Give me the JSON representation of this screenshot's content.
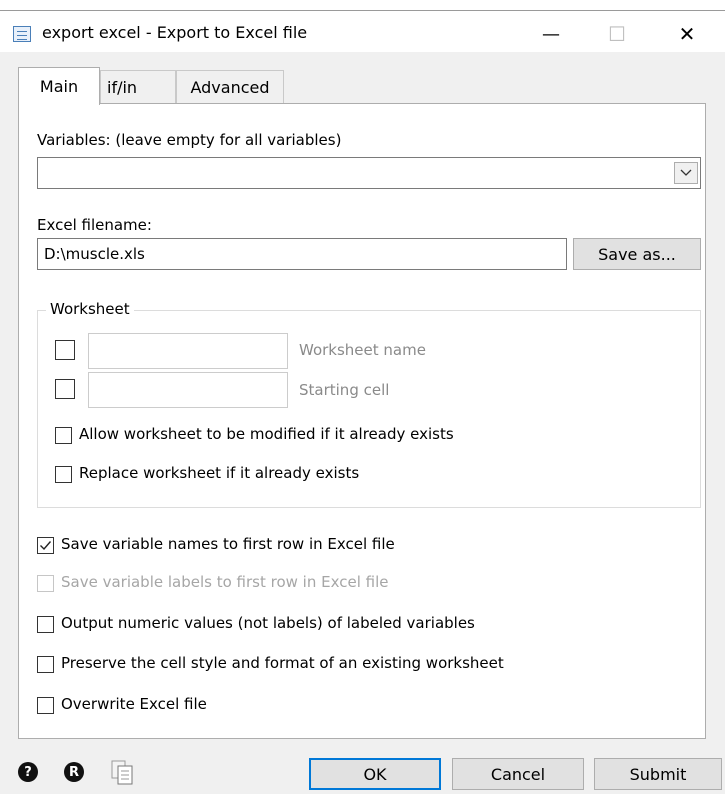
{
  "window": {
    "title": "export excel - Export to Excel file",
    "minimize_glyph": "—",
    "maximize_glyph": "☐",
    "close_glyph": "✕"
  },
  "tabs": [
    {
      "label": "Main",
      "active": true
    },
    {
      "label": "if/in",
      "active": false
    },
    {
      "label": "Advanced",
      "active": false
    }
  ],
  "variables": {
    "label": "Variables: (leave empty for all variables)",
    "value": ""
  },
  "excel": {
    "label": "Excel filename:",
    "value": "D:\\muscle.xls",
    "save_as_label": "Save as..."
  },
  "worksheet": {
    "group_title": "Worksheet",
    "name_label": "Worksheet name",
    "name_checked": false,
    "cell_label": "Starting cell",
    "cell_checked": false,
    "modify_label": "Allow worksheet to be modified if it already exists",
    "modify_checked": false,
    "replace_label": "Replace worksheet if it already exists",
    "replace_checked": false
  },
  "options": [
    {
      "label": "Save variable names to first row in Excel file",
      "checked": true,
      "enabled": true
    },
    {
      "label": "Save variable labels to first row in Excel file",
      "checked": false,
      "enabled": false
    },
    {
      "label": "Output numeric values (not labels) of labeled variables",
      "checked": false,
      "enabled": true
    },
    {
      "label": "Preserve the cell style and format of an existing worksheet",
      "checked": false,
      "enabled": true
    },
    {
      "label": "Overwrite Excel file",
      "checked": false,
      "enabled": true
    }
  ],
  "footer": {
    "help_glyph": "?",
    "reset_glyph": "R",
    "ok_label": "OK",
    "cancel_label": "Cancel",
    "submit_label": "Submit"
  },
  "icons": [
    "app-dialog-icon",
    "chevron-down-icon",
    "checkmark-icon",
    "help-icon",
    "reset-icon",
    "copy-icon"
  ]
}
